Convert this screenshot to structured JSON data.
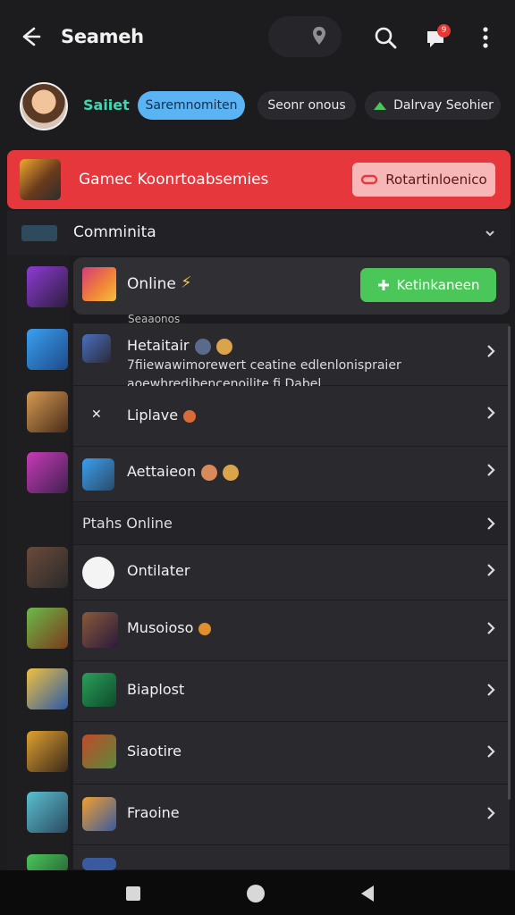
{
  "header": {
    "title": "Seameh"
  },
  "badges": {
    "notifications": "9"
  },
  "profile": {
    "status_label": "Saiiet"
  },
  "chips": [
    {
      "label": "Saremnomiten"
    },
    {
      "label": "Seonr onous"
    },
    {
      "label": "Dalrvay Seohier"
    }
  ],
  "banner": {
    "text": "Gamec Koonrtoabsemies",
    "button": "Rotartinloenico"
  },
  "section": {
    "label": "Comminita"
  },
  "online": {
    "label": "Online",
    "button": "Ketinkaneen",
    "caption": "Seaaonos"
  },
  "rows": [
    {
      "label": "Hetaitair",
      "desc": "7fiiewawimorewert ceatine edlenlonispraier aoewhredibencenoilite fi Dabel."
    },
    {
      "label": "Liplave"
    },
    {
      "label": "Aettaieon"
    },
    {
      "label": "Ptahs Online"
    },
    {
      "label": "Ontilater"
    },
    {
      "label": "Musoioso"
    },
    {
      "label": "Biaplost"
    },
    {
      "label": "Siaotire"
    },
    {
      "label": "Fraoine"
    }
  ],
  "colors": {
    "banner": "#e5373c",
    "chip_active": "#5ab3f3",
    "cta_green": "#4bc75a",
    "status": "#3fd6b0"
  },
  "icons": [
    "back-arrow-icon",
    "location-pin-icon",
    "search-icon",
    "chat-icon",
    "more-vert-icon",
    "chevron-right-icon",
    "plus-icon",
    "unlink-icon"
  ]
}
